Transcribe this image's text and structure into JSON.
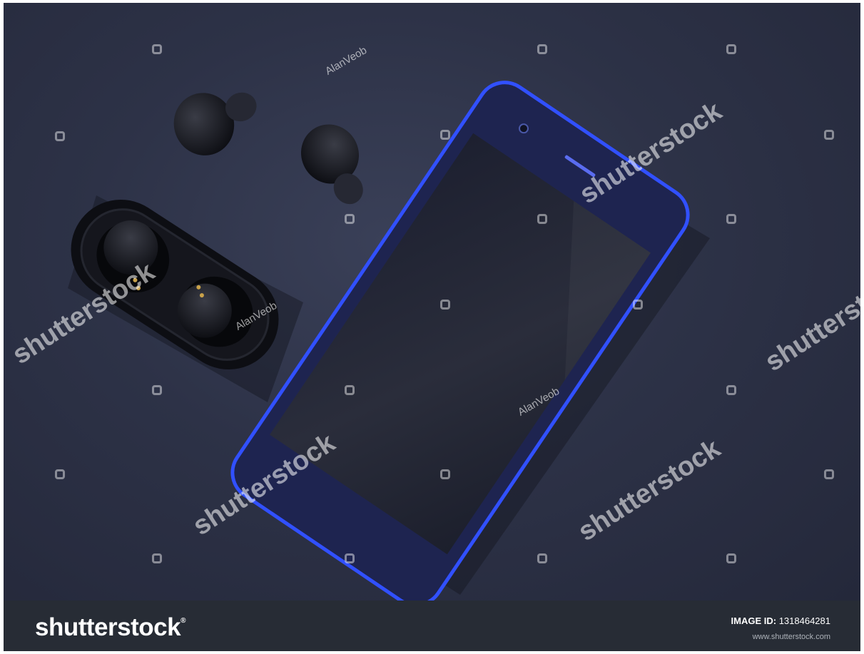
{
  "photo": {
    "subject": "blue smartphone and black wireless earbuds with charging case on dark fabric",
    "watermark_text": "shutterstock",
    "author_watermark": "AlanVeob"
  },
  "footer": {
    "brand": "shutterstock",
    "image_id_label": "IMAGE ID:",
    "image_id_value": "1318464281",
    "url": "www.shutterstock.com"
  },
  "colors": {
    "background_fabric": "#2d3247",
    "phone_body": "#1e2450",
    "phone_edge": "#2b3fe0",
    "footer_bg": "#272c35"
  }
}
